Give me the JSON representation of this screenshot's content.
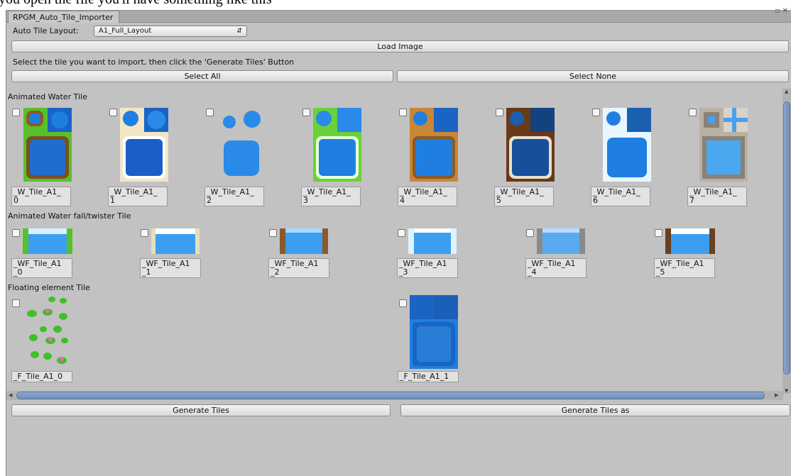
{
  "caption": "you open the file you'll have something like this",
  "window": {
    "tab_title": "RPGM_Auto_Tile_Importer",
    "controls": "▫ ✕"
  },
  "toolbar": {
    "layout_label": "Auto Tile Layout:",
    "layout_value": "A1_Full_Layout",
    "load_image": "Load Image",
    "instruction": "Select the tile you want to import, then click the 'Generate Tiles' Button",
    "select_all": "Select All",
    "select_none": "Select None"
  },
  "sections": [
    {
      "title": "Animated Water Tile",
      "tiles": [
        "_W_Tile_A1_\n0",
        "_W_Tile_A1_\n1",
        "_W_Tile_A1_\n2",
        "_W_Tile_A1_\n3",
        "_W_Tile_A1_\n4",
        "_W_Tile_A1_\n5",
        "_W_Tile_A1_\n6",
        "_W_Tile_A1_\n7"
      ]
    },
    {
      "title": "Animated Water fall/twister Tile",
      "tiles": [
        "_WF_Tile_A1\n_0",
        "_WF_Tile_A1\n_1",
        "_WF_Tile_A1\n_2",
        "_WF_Tile_A1\n_3",
        "_WF_Tile_A1\n_4",
        "_WF_Tile_A1\n_5"
      ]
    },
    {
      "title": "Floating element Tile",
      "tiles": [
        "_F_Tile_A1_0",
        "_F_Tile_A1_1"
      ]
    }
  ],
  "footer": {
    "generate": "Generate Tiles",
    "generate_as": "Generate Tiles as"
  },
  "colors": {
    "panel": "#c2c2c2",
    "water": "#1f7fe0",
    "grass": "#58c02a",
    "sand": "#f1e6c8",
    "dirt": "#b5752e",
    "scroll": "#7a97c0"
  }
}
